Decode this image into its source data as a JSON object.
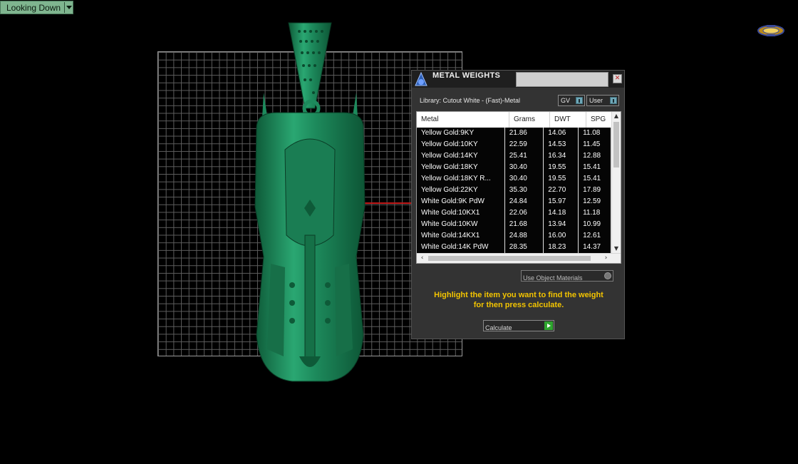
{
  "viewport": {
    "view_label": "Looking Down"
  },
  "panel": {
    "title": "METAL WEIGHTS",
    "library": "Library: Cutout White - (Fast)-Metal",
    "toggle_gv": "GV",
    "toggle_user": "User",
    "columns": [
      "Metal",
      "Grams",
      "DWT",
      "SPG"
    ],
    "rows": [
      [
        "Yellow Gold:9KY",
        "21.86",
        "14.06",
        "11.08"
      ],
      [
        "Yellow Gold:10KY",
        "22.59",
        "14.53",
        "11.45"
      ],
      [
        "Yellow Gold:14KY",
        "25.41",
        "16.34",
        "12.88"
      ],
      [
        "Yellow Gold:18KY",
        "30.40",
        "19.55",
        "15.41"
      ],
      [
        "Yellow Gold:18KY R...",
        "30.40",
        "19.55",
        "15.41"
      ],
      [
        "Yellow Gold:22KY",
        "35.30",
        "22.70",
        "17.89"
      ],
      [
        "White Gold:9K PdW",
        "24.84",
        "15.97",
        "12.59"
      ],
      [
        "White Gold:10KX1",
        "22.06",
        "14.18",
        "11.18"
      ],
      [
        "White Gold:10KW",
        "21.68",
        "13.94",
        "10.99"
      ],
      [
        "White Gold:14KX1",
        "24.88",
        "16.00",
        "12.61"
      ],
      [
        "White Gold:14K PdW",
        "28.35",
        "18.23",
        "14.37"
      ]
    ],
    "use_object_materials": "Use Object Materials",
    "instructions_line1": "Highlight the item you want to find the weight",
    "instructions_line2": "for then press calculate.",
    "calculate": "Calculate"
  },
  "colors": {
    "model_green": "#1f8a5c",
    "instructions": "#f3c400",
    "viewport_label_bg": "#7fb58f"
  }
}
